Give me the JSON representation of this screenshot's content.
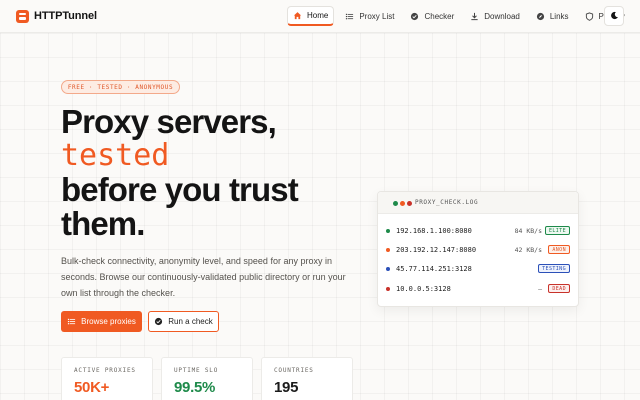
{
  "brand": {
    "name": "HTTPTunnel"
  },
  "nav": {
    "items": [
      {
        "label": "Home",
        "icon": "home-icon",
        "active": true
      },
      {
        "label": "Proxy List",
        "icon": "list-icon",
        "active": false
      },
      {
        "label": "Checker",
        "icon": "check-circle-icon",
        "active": false
      },
      {
        "label": "Download",
        "icon": "download-icon",
        "active": false
      },
      {
        "label": "Links",
        "icon": "compass-icon",
        "active": false
      },
      {
        "label": "Privacy",
        "icon": "shield-icon",
        "active": false
      }
    ],
    "theme_toggle_icon": "moon-icon"
  },
  "hero": {
    "pill": "FREE · TESTED · ANONYMOUS",
    "line1": "Proxy servers,",
    "line2": "tested",
    "line3": "before you trust",
    "line4": "them.",
    "description": "Bulk-check connectivity, anonymity level, and speed for any proxy in seconds. Browse our continuously-validated public directory or run your own list through the checker.",
    "primary_button": "Browse proxies",
    "secondary_button": "Run a check"
  },
  "stats": [
    {
      "label": "ACTIVE PROXIES",
      "value": "50K+"
    },
    {
      "label": "UPTIME SLO",
      "value": "99.5%"
    },
    {
      "label": "COUNTRIES",
      "value": "195"
    }
  ],
  "log_card": {
    "title": "PROXY_CHECK.LOG",
    "rows": [
      {
        "ip": "192.168.1.100:8080",
        "speed": "84 KB/s",
        "badge": "ELITE",
        "color": "#1e8a4a"
      },
      {
        "ip": "203.192.12.147:8080",
        "speed": "42 KB/s",
        "badge": "ANON",
        "color": "#f05a22"
      },
      {
        "ip": "45.77.114.251:3128",
        "speed": "—",
        "badge": "TESTING",
        "color": "#2b50b8"
      },
      {
        "ip": "10.0.0.5:3128",
        "speed": "—",
        "badge": "DEAD",
        "color": "#c8322a"
      }
    ]
  },
  "colors": {
    "accent": "#f05a22",
    "success": "#1e8a4a",
    "info": "#2b50b8",
    "danger": "#c8322a"
  }
}
